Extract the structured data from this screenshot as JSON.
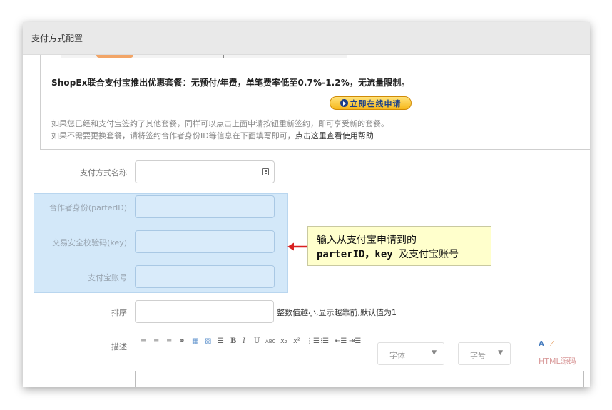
{
  "dialog": {
    "title": "支付方式配置"
  },
  "promo": {
    "headline": "ShopEx联合支付宝推出优惠套餐：无预付/年费，单笔费率低至0.7%-1.2%，无流量限制。",
    "apply_button": "立即在线申请",
    "note1": "如果您已经和支付宝签约了其他套餐，同样可以点击上面申请按钮重新签约，即可享受新的套餐。",
    "note2_prefix": "如果不需要更换套餐，请将签约合作者身份ID等信息在下面填写即可，",
    "note2_link": "点击这里查看使用帮助"
  },
  "form": {
    "payment_name_label": "支付方式名称",
    "partner_id_label": "合作者身份(parterID)",
    "key_label": "交易安全校验码(key)",
    "account_label": "支付宝账号",
    "order_label": "排序",
    "order_hint": "整数值越小,显示越靠前,默认值为1",
    "description_label": "描述"
  },
  "callout": {
    "line1": "输入从支付宝申请到的",
    "line2_a": "parterID，key",
    "line2_b": "及支付宝账号"
  },
  "toolbar": {
    "align_left": "≡",
    "align_center": "≡",
    "align_right": "≡",
    "link": "⚭",
    "table": "▦",
    "image": "▨",
    "hr": "☰",
    "bold": "B",
    "italic": "I",
    "underline": "U",
    "strikethrough": "ABC",
    "subscript": "x₂",
    "superscript": "x²",
    "ordered_list": "⋮☰",
    "unordered_list": "⁝☰",
    "outdent": "⇤☰",
    "indent": "⇥☰",
    "font_family": "字体",
    "font_size": "字号",
    "font_color": "A",
    "highlight": "⁄",
    "html_source": "HTML源码"
  },
  "colors": {
    "highlight_bg": "#d3e8f9",
    "callout_bg": "#ffffcc",
    "arrow": "#d92121",
    "apply_button": "#f7b81b"
  }
}
